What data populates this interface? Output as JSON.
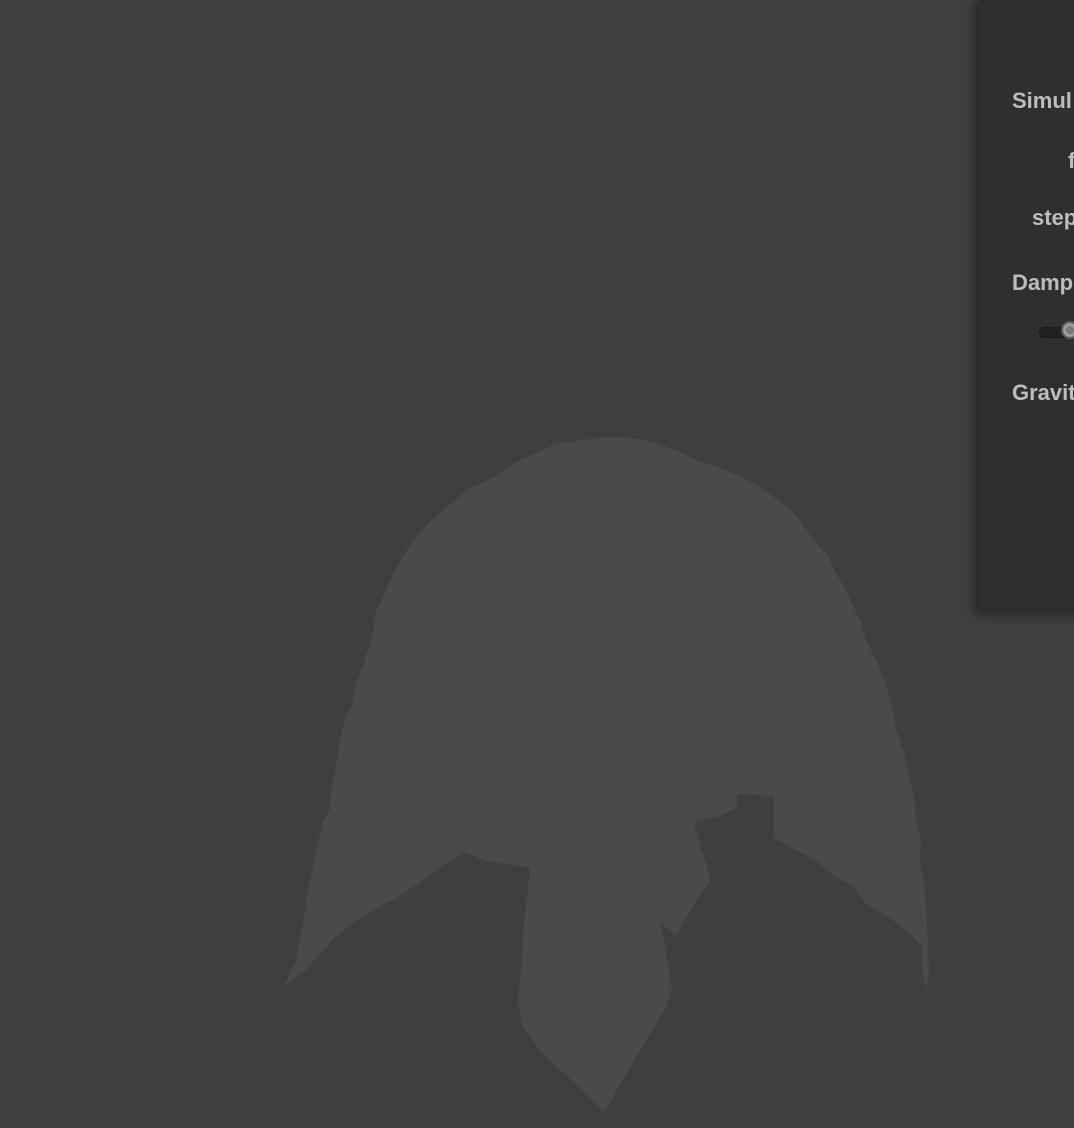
{
  "viewport": {
    "background_color": "#3f3f3f",
    "cloth_color": "#4a4a4a"
  },
  "controls": {
    "simulation_label": "Simul",
    "f_label": "f",
    "steps_label": "step",
    "damping_label": "Damp",
    "damping_slider_level": 0.35,
    "gravity_label": "Gravit"
  }
}
